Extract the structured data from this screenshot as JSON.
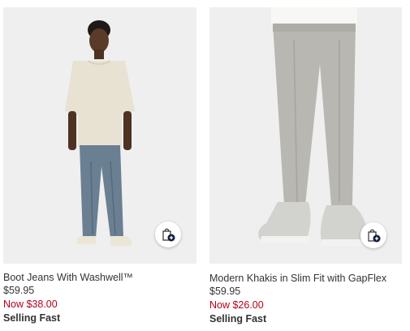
{
  "products": [
    {
      "name": "Boot Jeans With Washwell™",
      "original_price": "$59.95",
      "sale_price": "Now $38.00",
      "badge": "Selling Fast",
      "quick_add_icon": "shopping-bag-plus-icon"
    },
    {
      "name": "Modern Khakis in Slim Fit with GapFlex",
      "original_price": "$59.95",
      "sale_price": "Now $26.00",
      "badge": "Selling Fast",
      "quick_add_icon": "shopping-bag-plus-icon"
    }
  ],
  "colors": {
    "sale": "#b3001b",
    "text": "#333333",
    "photo_bg": "#efefef",
    "bag_badge": "#0e1a3b"
  }
}
